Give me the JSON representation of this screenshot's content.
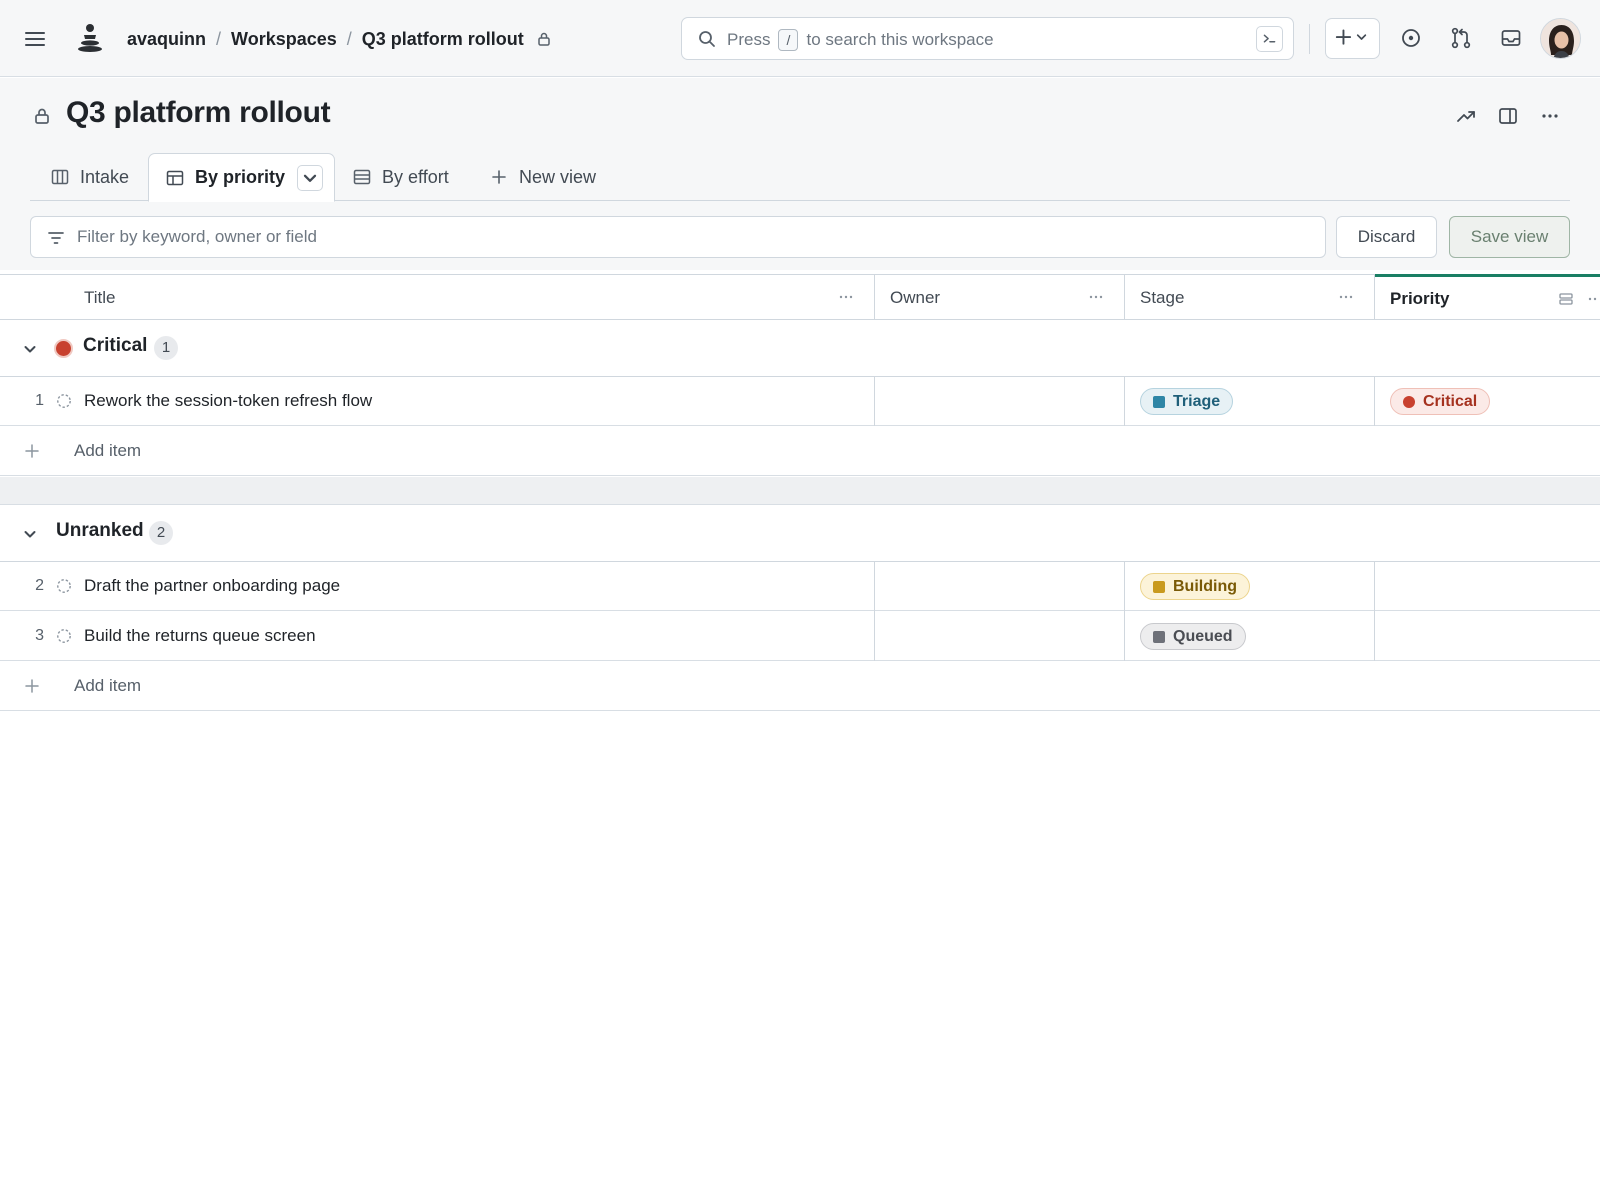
{
  "header": {
    "breadcrumb": {
      "owner": "avaquinn",
      "section": "Workspaces",
      "project": "Q3 platform rollout"
    },
    "search": {
      "press": "Press",
      "key": "/",
      "suffix": "to search this workspace"
    }
  },
  "project": {
    "title": "Q3 platform rollout"
  },
  "tabs": [
    {
      "label": "Intake",
      "icon": "board-icon",
      "has_dot": true
    },
    {
      "label": "By priority",
      "icon": "table-icon",
      "active": true
    },
    {
      "label": "By effort",
      "icon": "list-icon"
    },
    {
      "label": "New view",
      "icon": "plus-icon"
    }
  ],
  "filter": {
    "placeholder": "Filter by keyword, owner or field"
  },
  "buttons": {
    "discard": "Discard",
    "save": "Save view"
  },
  "columns": [
    {
      "label": "Title"
    },
    {
      "label": "Owner"
    },
    {
      "label": "Stage"
    },
    {
      "label": "Priority",
      "active": true
    }
  ],
  "groups": [
    {
      "name": "Critical",
      "count": "1",
      "color": "#c8412f",
      "items": [
        {
          "num": "1",
          "title": "Rework the session-token refresh flow",
          "stage": "Triage",
          "priority": "Critical"
        }
      ]
    },
    {
      "name": "Unranked",
      "count": "2",
      "items": [
        {
          "num": "2",
          "title": "Draft the partner onboarding page",
          "stage": "Building",
          "priority": ""
        },
        {
          "num": "3",
          "title": "Build the returns queue screen",
          "stage": "Queued",
          "priority": ""
        }
      ]
    }
  ],
  "add_item_label": "Add item",
  "colors": {
    "accent": "#1a7f64",
    "stage_triage": "#2f86a6",
    "stage_building": "#c99a1e",
    "stage_queued": "#6e7179",
    "priority_critical": "#c8412f"
  }
}
